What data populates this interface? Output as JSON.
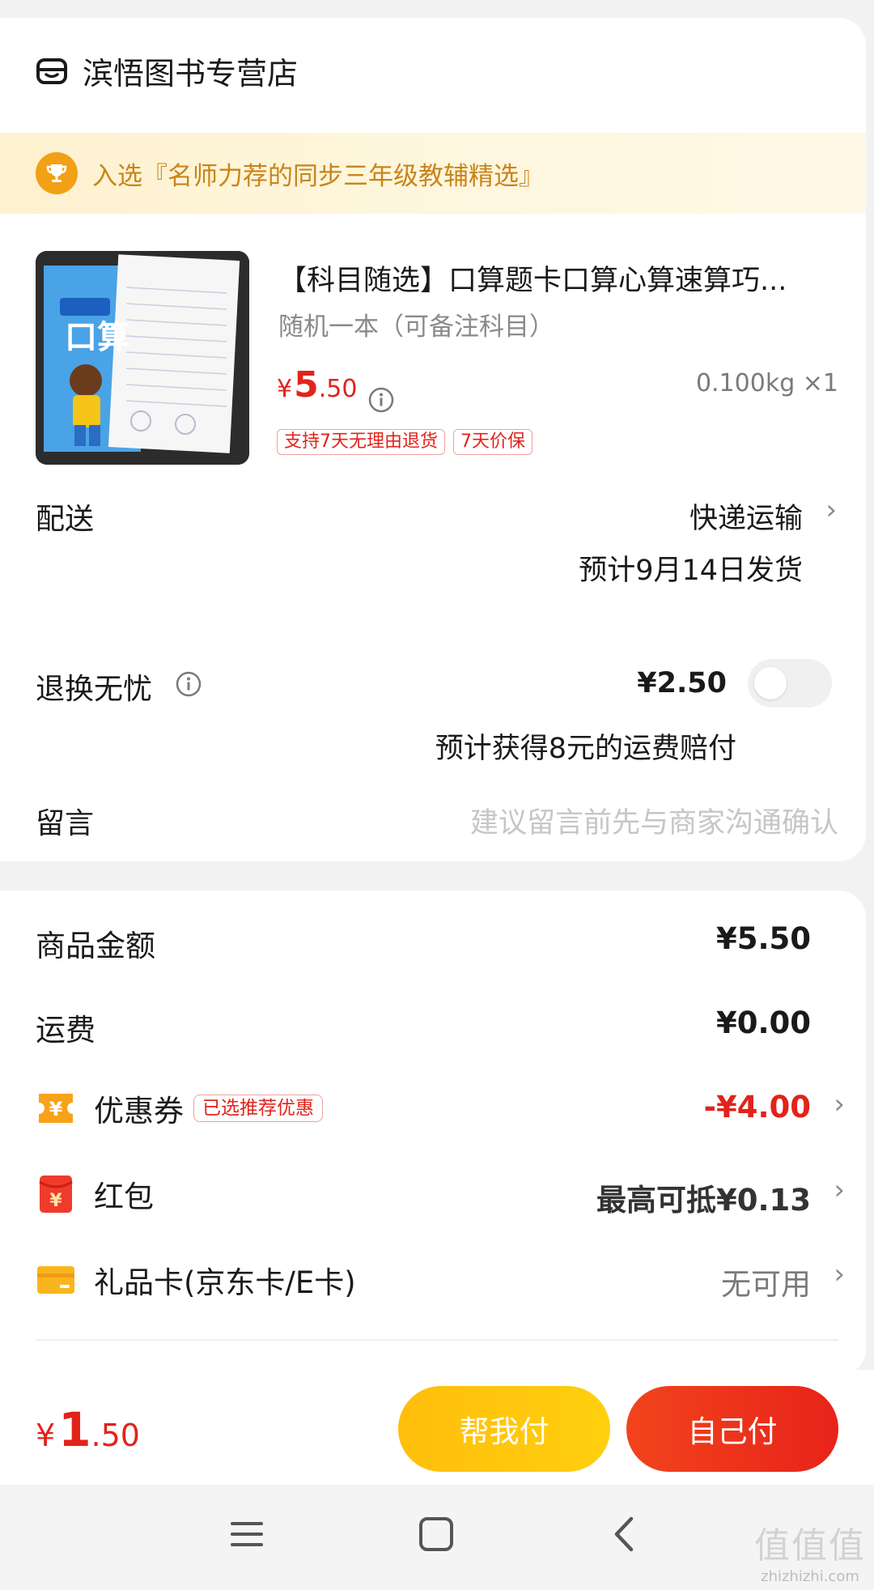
{
  "store": {
    "name": "滨悟图书专营店",
    "icon": "store-icon"
  },
  "award": {
    "text": "入选『名师力荐的同步三年级教辅精选』",
    "icon": "trophy-icon"
  },
  "product": {
    "title": "【科目随选】口算题卡口算心算速算巧...",
    "spec": "随机一本（可备注科目）",
    "price_currency": "¥",
    "price_int": "5",
    "price_dec": ".50",
    "weight_qty": "0.100kg ×1",
    "tags": [
      "支持7天无理由退货",
      "7天价保"
    ],
    "thumb_text": "口算"
  },
  "delivery": {
    "label": "配送",
    "method": "快递运输",
    "eta": "预计9月14日发货"
  },
  "returns": {
    "label": "退换无忧",
    "price": "¥2.50",
    "note": "预计获得8元的运费赔付",
    "toggle_on": false
  },
  "message": {
    "label": "留言",
    "placeholder": "建议留言前先与商家沟通确认"
  },
  "summary": {
    "goods_label": "商品金额",
    "goods_value": "¥5.50",
    "shipping_label": "运费",
    "shipping_value": "¥0.00",
    "coupon_label": "优惠券",
    "coupon_tag": "已选推荐优惠",
    "coupon_value": "-¥4.00",
    "redpacket_label": "红包",
    "redpacket_value": "最高可抵¥0.13",
    "giftcard_label": "礼品卡(京东卡/E卡)",
    "giftcard_value": "无可用"
  },
  "paybar": {
    "currency": "¥",
    "total_int": "1",
    "total_dec": ".50",
    "help_pay": "帮我付",
    "self_pay": "自己付"
  },
  "watermark": {
    "big": "值值值",
    "small": "zhizhizhi.com"
  },
  "colors": {
    "accent_red": "#e2231a",
    "gold": "#c8851a",
    "yellow_btn": "#ffc20e"
  }
}
